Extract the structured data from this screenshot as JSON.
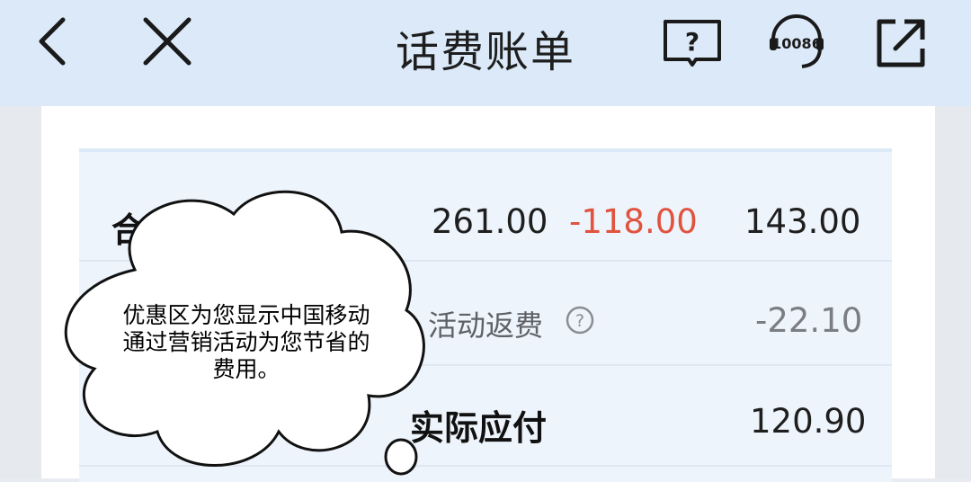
{
  "header": {
    "title": "话费账单",
    "back_icon": "chevron-left-icon",
    "close_icon": "close-icon",
    "help_book_icon": "book-question-icon",
    "service_hotline": "10086",
    "share_icon": "external-link-icon"
  },
  "bill": {
    "total_row": {
      "label": "合计",
      "amount": "261.00",
      "discount": "-118.00",
      "net": "143.00"
    },
    "activity_row": {
      "label": "活动返费",
      "amount": "-22.10"
    },
    "payable_row": {
      "label": "实际应付",
      "amount": "120.90"
    }
  },
  "callout": {
    "text_line1": "优惠区为您显示中国移动",
    "text_line2": "通过营销活动为您节省的",
    "text_line3": "费用。"
  },
  "colors": {
    "header_bg": "#dbe9f9",
    "discount_red": "#e0533f",
    "table_bg": "#eef4fb"
  }
}
